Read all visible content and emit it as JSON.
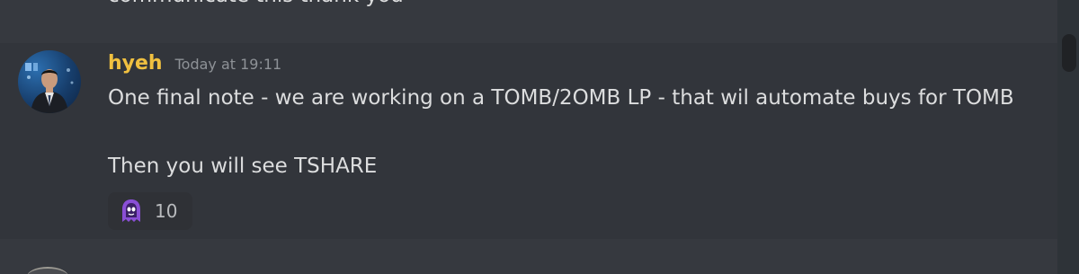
{
  "previous_message": {
    "text": "communicate this thank you"
  },
  "message": {
    "username": "hyeh",
    "timestamp": "Today at 19:11",
    "lines": [
      "One final note - we are working on a TOMB/2OMB LP - that wil automate buys for TOMB",
      "Then you will see TSHARE"
    ],
    "reaction": {
      "emoji": "purple-ghost-emoji",
      "count": "10"
    }
  },
  "colors": {
    "background": "#36393f",
    "hover_background": "#32353b",
    "username": "#f0c040",
    "text": "#dcddde",
    "timestamp": "#8e9297"
  }
}
